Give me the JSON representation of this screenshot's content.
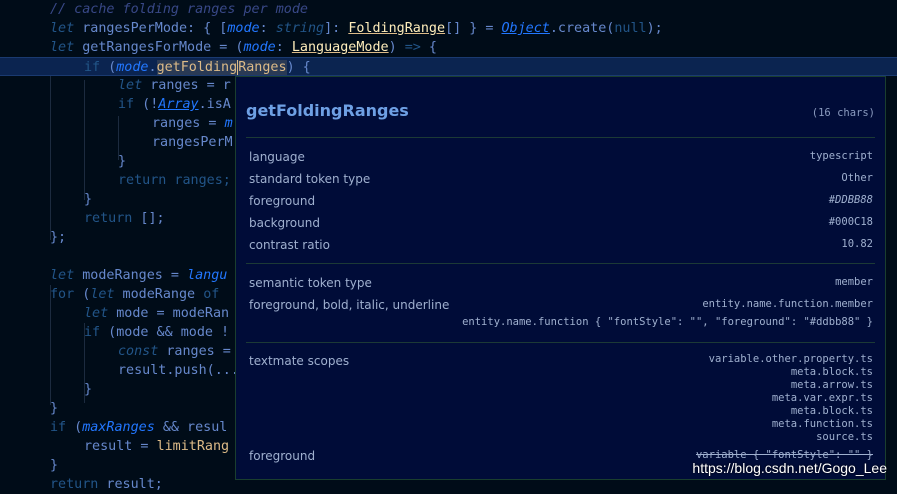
{
  "editor": {
    "lines": [
      "// cache folding ranges per mode",
      "let rangesPerMode: { [mode: string]: FoldingRange[] } = Object.create(null);",
      "let getRangesForMode = (mode: LanguageMode) => {",
      "if (mode.getFoldingRanges) {",
      "let ranges = r",
      "if (!Array.isA",
      "ranges = m",
      "rangesPerM",
      "}",
      "return ranges;",
      "}",
      "return [];",
      "};",
      "",
      "let modeRanges = langu",
      "for (let modeRange of",
      "let mode = modeRan",
      "if (mode && mode !",
      "const ranges =",
      "result.push(...",
      "}",
      "}",
      "if (maxRanges && resul",
      "result = limitRang",
      "}",
      "return result;"
    ]
  },
  "hover": {
    "title": "getFoldingRanges",
    "char_count": "(16 chars)",
    "rows_general": [
      {
        "key": "language",
        "value": "typescript"
      },
      {
        "key": "standard token type",
        "value": "Other"
      },
      {
        "key": "foreground",
        "value": "#DDBB88"
      },
      {
        "key": "background",
        "value": "#000C18"
      },
      {
        "key": "contrast ratio",
        "value": "10.82"
      }
    ],
    "semantic_label": "semantic token type",
    "semantic_value": "member",
    "fg_label": "foreground, bold, italic, underline",
    "fg_value1": "entity.name.function.member",
    "fg_value2": "entity.name.function { \"fontStyle\": \"\", \"foreground\": \"#ddbb88\" }",
    "textmate_label": "textmate scopes",
    "scopes": [
      "variable.other.property.ts",
      "meta.block.ts",
      "meta.arrow.ts",
      "meta.var.expr.ts",
      "meta.block.ts",
      "meta.function.ts",
      "source.ts"
    ],
    "foreground_label": "foreground",
    "foreground_value": "variable { \"fontStyle\": \"\" }"
  },
  "watermark": "https://blog.csdn.net/Gogo_Lee",
  "colors": {
    "background": "#000c18",
    "function": "#ddbb88",
    "keyword": "#225588",
    "text": "#6688cc"
  }
}
